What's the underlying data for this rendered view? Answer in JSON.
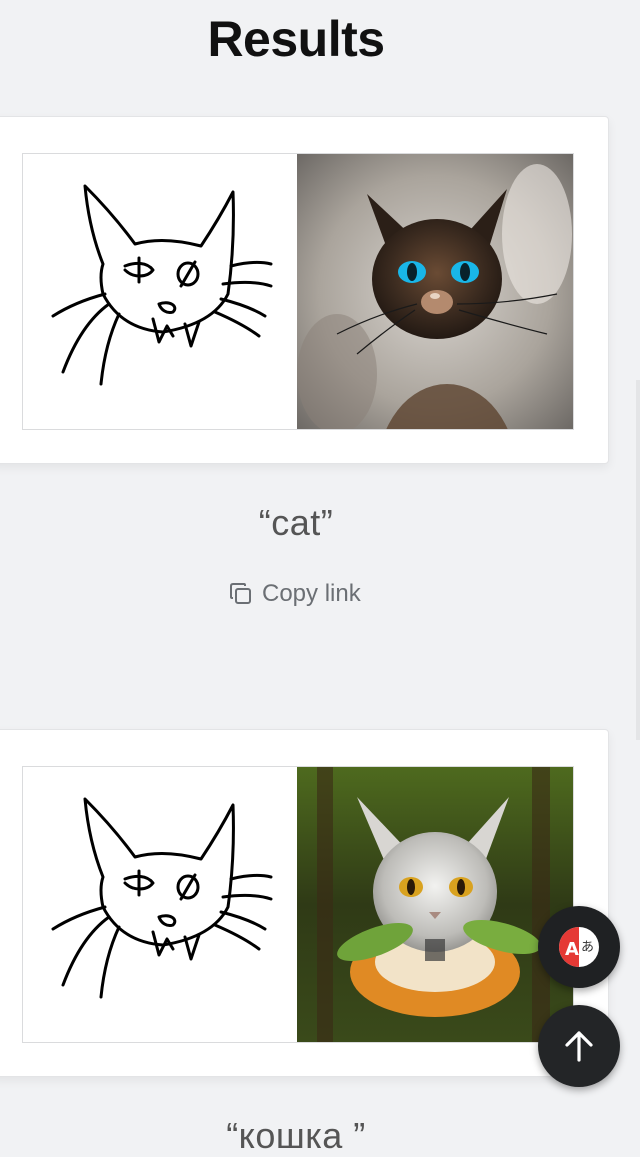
{
  "page": {
    "title": "Results"
  },
  "results": [
    {
      "caption": "“cat”",
      "copy_label": "Copy link"
    },
    {
      "caption": "“кошка ”"
    }
  ],
  "icons": {
    "copy": "copy-icon",
    "translate": "translate-icon",
    "scroll_top": "arrow-up-icon"
  },
  "colors": {
    "background": "#f1f2f4",
    "card": "#ffffff",
    "fab": "#1f2123",
    "translate_accent": "#e53935"
  }
}
